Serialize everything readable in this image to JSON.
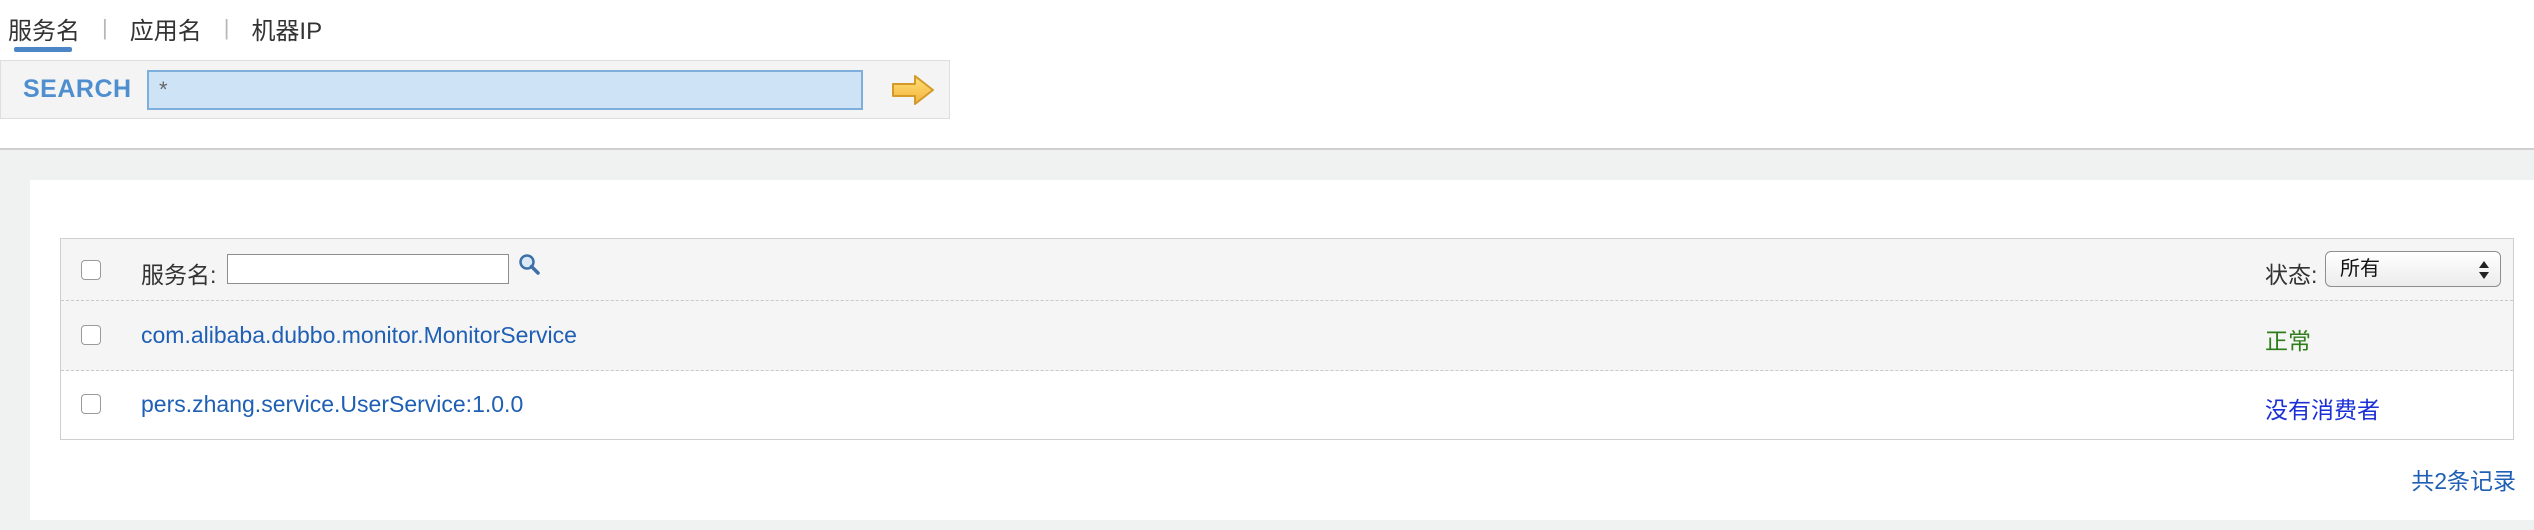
{
  "tabs": [
    {
      "label": "服务名",
      "active": true
    },
    {
      "label": "应用名",
      "active": false
    },
    {
      "label": "机器IP",
      "active": false
    }
  ],
  "tab_separator": "|",
  "search": {
    "label": "SEARCH",
    "value": "*",
    "go_icon": "arrow-right-icon"
  },
  "table": {
    "header": {
      "name_label": "服务名:",
      "name_filter_value": "",
      "status_label": "状态:",
      "status_selected": "所有"
    },
    "rows": [
      {
        "service": "com.alibaba.dubbo.monitor.MonitorService",
        "status": "正常"
      },
      {
        "service": "pers.zhang.service.UserService:1.0.0",
        "status": "没有消费者"
      }
    ],
    "total_text": "共2条记录"
  },
  "colors": {
    "link": "#1f5fb4",
    "status_ok": "#2e7d1a",
    "status_no_consumer": "#1a2fd6",
    "accent": "#4c86c6",
    "search_input_bg": "#cfe3f6"
  }
}
